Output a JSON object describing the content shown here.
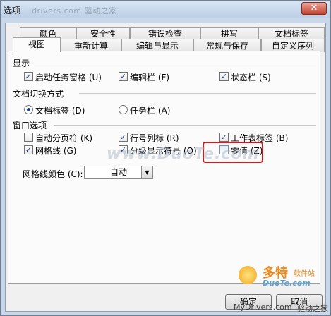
{
  "window": {
    "title": "选项",
    "watermark_top": "drivers.com  驱动之家",
    "close_symbol": "✕"
  },
  "tabs_row1": [
    "颜色",
    "安全性",
    "错误检查",
    "拼写",
    "文档标签"
  ],
  "tabs_row2": [
    "视图",
    "重新计算",
    "编辑与显示",
    "常规与保存",
    "自定义序列"
  ],
  "sections": {
    "display": {
      "title": "显示",
      "items": [
        {
          "label": "启动任务窗格 (U)",
          "checked": true
        },
        {
          "label": "编辑栏 (F)",
          "checked": true
        },
        {
          "label": "状态栏 (S)",
          "checked": true
        }
      ]
    },
    "doc_switch": {
      "title": "文档切换方式",
      "options": [
        {
          "label": "文档标签 (D)",
          "selected": true
        },
        {
          "label": "任务栏 (A)",
          "selected": false
        }
      ]
    },
    "window_options": {
      "title": "窗口选项",
      "items": [
        {
          "label": "自动分页符 (K)",
          "checked": false
        },
        {
          "label": "行号列标 (R)",
          "checked": true
        },
        {
          "label": "工作表标签 (B)",
          "checked": true
        },
        {
          "label": "网格线 (G)",
          "checked": true
        },
        {
          "label": "分级显示符号 (O)",
          "checked": true
        },
        {
          "label": "零值 (Z)",
          "checked": false
        }
      ],
      "gridline_color_label": "网格线颜色 (C):",
      "gridline_color_value": "自动"
    }
  },
  "watermarks": {
    "center": "www.DuoTe.com",
    "logo_main": "多特",
    "logo_sub": "软件站",
    "logo_url": "DuoTe.com",
    "bottom_left": "MyDrivers.com",
    "bottom_right": "驱动之家"
  },
  "buttons": {
    "ok": "确定",
    "cancel": "取消"
  },
  "colors": {
    "highlight_box": "#c81e1e",
    "check_mark": "#1c3f87"
  }
}
